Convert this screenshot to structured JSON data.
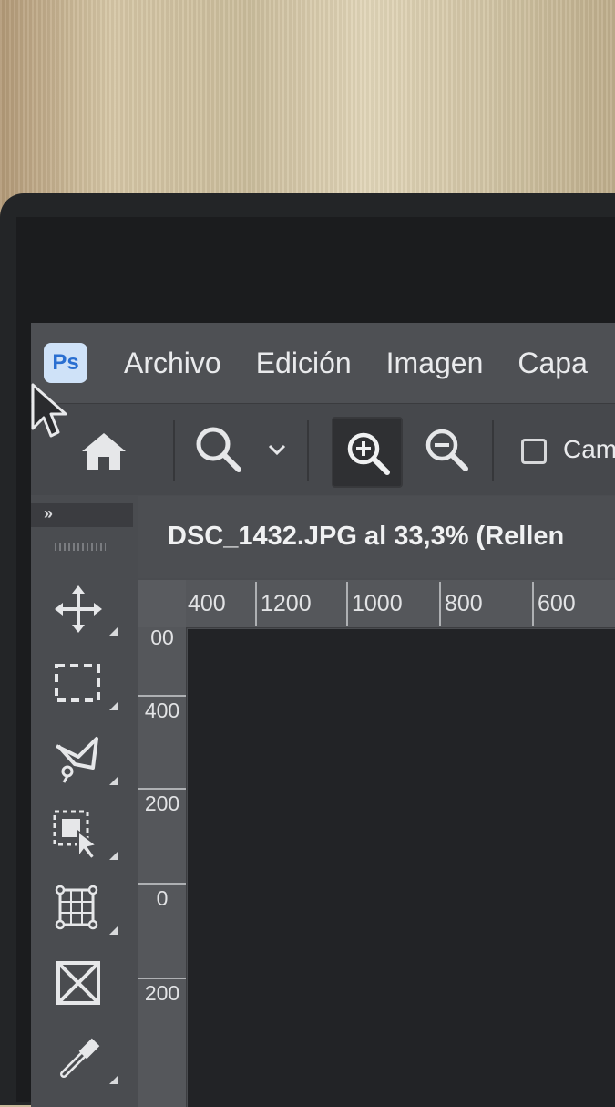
{
  "app": {
    "logo_text": "Ps"
  },
  "menu": [
    "Archivo",
    "Edición",
    "Imagen",
    "Capa"
  ],
  "options_bar": {
    "icons": [
      "home-icon",
      "zoom-icon",
      "chevron-down-icon",
      "zoom-in-icon",
      "zoom-out-icon"
    ],
    "checkbox_label": "Cam",
    "checkbox_checked": false
  },
  "tools_panel": {
    "collapse_label": "»",
    "tools": [
      "move-tool-icon",
      "marquee-tool-icon",
      "lasso-tool-icon",
      "object-selection-tool-icon",
      "crop-tool-icon",
      "frame-tool-icon",
      "eyedropper-tool-icon"
    ]
  },
  "document": {
    "tab_title": "DSC_1432.JPG al 33,3% (Rellen"
  },
  "rulers": {
    "horizontal": [
      "400",
      "1200",
      "1000",
      "800",
      "600"
    ],
    "vertical": [
      "00",
      "400",
      "200",
      "0",
      "200"
    ]
  },
  "colors": {
    "accent_logo_bg": "#cfe2f8",
    "accent_logo_text": "#2a6fd1",
    "ui_bg": "#4e5054",
    "canvas_bg": "#222326"
  }
}
